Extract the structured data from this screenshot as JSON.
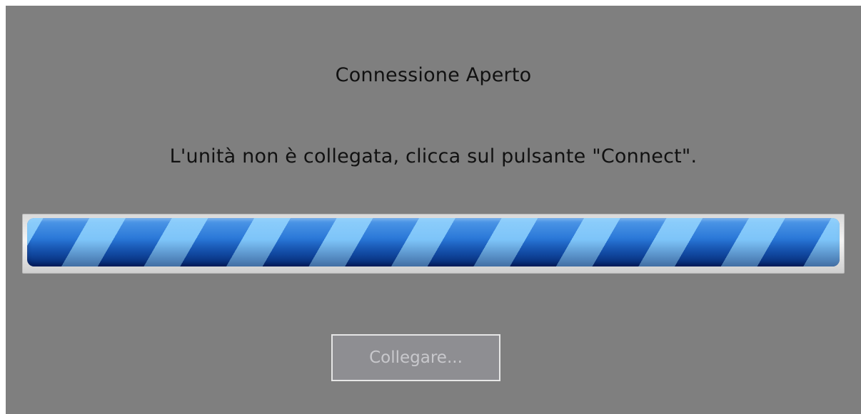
{
  "dialog": {
    "title": "Connessione Aperto",
    "message": "L'unità non è collegata, clicca sul pulsante \"Connect\".",
    "progress": {
      "state": "indeterminate",
      "fill_fraction": 1.0,
      "bar_color": "#2a78d8",
      "stripe_color": "#8cd2ff"
    },
    "connect_button": {
      "label": "Collegare...",
      "enabled": false
    }
  },
  "colors": {
    "background": "#7f7f7f",
    "text": "#111111",
    "button_disabled_bg": "#8e8e92",
    "button_disabled_text": "#c8c8cc"
  }
}
